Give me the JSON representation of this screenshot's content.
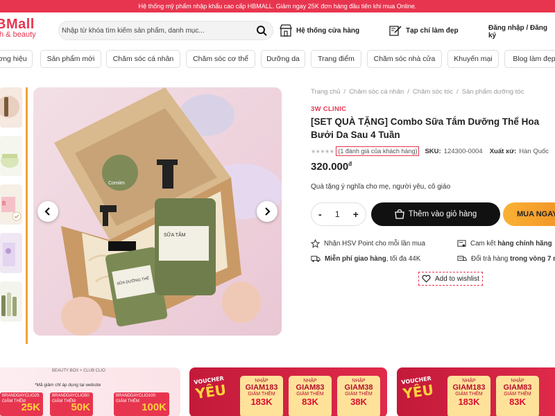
{
  "topbar": {
    "text": "Hệ thống mỹ phẩm nhập khẩu cao cấp HBMALL. Giảm ngay 25K đơn hàng đầu tiên khi mua Online."
  },
  "header": {
    "logo_main": "BMall",
    "logo_sub": "th & beauty",
    "search_placeholder": "Nhập từ khóa tìm kiếm sản phẩm, danh mục...",
    "store_system": "Hệ thống cửa hàng",
    "beauty_tips": "Tạp chí làm đẹp",
    "login": "Đăng nhập / Đăng ký"
  },
  "nav": {
    "items": [
      "ơng hiệu",
      "Sản phẩm mới",
      "Chăm sóc cá nhân",
      "Chăm sóc cơ thể",
      "Dưỡng da",
      "Trang điểm",
      "Chăm sóc nhà cửa",
      "Khuyến mại",
      "Blog làm đẹp"
    ]
  },
  "gallery": {
    "product_label_left": "SỮA DƯỠNG THỂ",
    "product_label_right": "SỮA TẮM",
    "box_logo": "Comiim"
  },
  "product": {
    "breadcrumb": [
      "Trang chủ",
      "Chăm sóc cá nhân",
      "Chăm sóc tóc",
      "Sản phẩm dưỡng tóc"
    ],
    "brand": "3W CLINIC",
    "title": "[SET QUÀ TẶNG] Combo Sữa Tắm Dưỡng Thể Hoa Bưởi Da Sau 4 Tuần",
    "review_text": "(1 đánh giá của khách hàng)",
    "sku_label": "SKU:",
    "sku": "124300-0004",
    "origin_label": "Xuất xứ:",
    "origin": "Hàn Quốc",
    "price": "320.000",
    "currency": "đ",
    "description": "Quà tặng ý nghĩa cho mẹ, người yêu, cô giáo",
    "qty_minus": "-",
    "qty_value": "1",
    "qty_plus": "+",
    "add_to_cart": "Thêm vào giỏ hàng",
    "buy_now": "MUA NGAY",
    "wishlist": "Add to wishlist",
    "rating": 0
  },
  "features": {
    "f1": "Nhận HSV Point cho mỗi lần mua",
    "f2_pre": "Cam kết",
    "f2_b": "hàng chính hãng",
    "f3_b": "Miễn phí giao hàng",
    "f3_post": ", tối đa 44K",
    "f4_pre": "Đổi trả hàng",
    "f4_b": "trong vòng 7 n"
  },
  "banners": {
    "b1_header": "BEAUTY BOX × CLUB CLIO",
    "b1_note": "*Mã giảm chỉ áp dụng tại website",
    "b1_cards": [
      {
        "code": "BRANDDAYCLIO25",
        "label": "GIẢM THÊM",
        "value": "25K"
      },
      {
        "code": "BRANDDAYCLIO50",
        "label": "GIẢM THÊM",
        "value": "50K"
      },
      {
        "code": "BRANDDAYCLIO100",
        "label": "GIẢM THÊM",
        "value": "100K"
      }
    ],
    "voucher_small": "VOUCHER",
    "voucher_big": "YÊU",
    "b2_cards": [
      {
        "top": "NHẬP",
        "code": "GIAM183",
        "label": "GIẢM THÊM",
        "value": "183K"
      },
      {
        "top": "NHẬP",
        "code": "GIAM83",
        "label": "GIẢM THÊM",
        "value": "83K"
      },
      {
        "top": "NHẬP",
        "code": "GIAM38",
        "label": "GIẢM THÊM",
        "value": "38K"
      }
    ],
    "b3_cards": [
      {
        "top": "NHẬP",
        "code": "GIAM183",
        "label": "GIẢM THÊM",
        "value": "183K"
      },
      {
        "top": "NHẬP",
        "code": "GIAM83",
        "label": "GIẢM THÊM",
        "value": "83K"
      }
    ]
  },
  "colors": {
    "brand": "#e8354f",
    "dark_button": "#111111",
    "buy_button": "#f9b234"
  }
}
